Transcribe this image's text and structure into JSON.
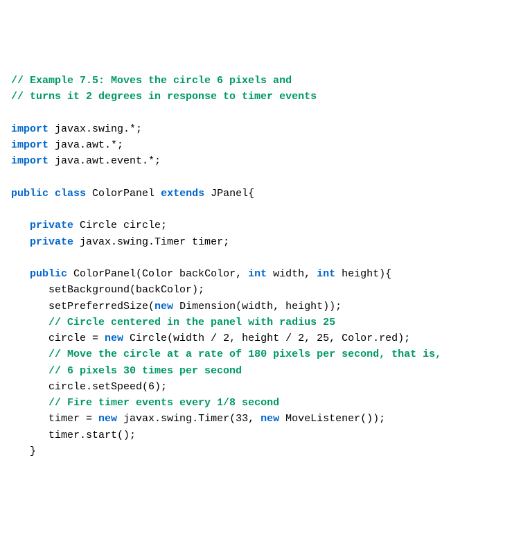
{
  "code": {
    "lines": [
      {
        "segments": [
          {
            "text": "// Example 7.5: Moves the circle 6 pixels and",
            "cls": "cm"
          }
        ]
      },
      {
        "segments": [
          {
            "text": "// turns it 2 degrees in response to timer events",
            "cls": "cm"
          }
        ]
      },
      {
        "segments": [
          {
            "text": "",
            "cls": ""
          }
        ]
      },
      {
        "segments": [
          {
            "text": "import",
            "cls": "kw"
          },
          {
            "text": " javax.swing.*;",
            "cls": ""
          }
        ]
      },
      {
        "segments": [
          {
            "text": "import",
            "cls": "kw"
          },
          {
            "text": " java.awt.*;",
            "cls": ""
          }
        ]
      },
      {
        "segments": [
          {
            "text": "import",
            "cls": "kw"
          },
          {
            "text": " java.awt.event.*;",
            "cls": ""
          }
        ]
      },
      {
        "segments": [
          {
            "text": "",
            "cls": ""
          }
        ]
      },
      {
        "segments": [
          {
            "text": "public class",
            "cls": "kw"
          },
          {
            "text": " ColorPanel ",
            "cls": ""
          },
          {
            "text": "extends",
            "cls": "kw"
          },
          {
            "text": " JPanel{",
            "cls": ""
          }
        ]
      },
      {
        "segments": [
          {
            "text": "",
            "cls": ""
          }
        ]
      },
      {
        "segments": [
          {
            "text": "   ",
            "cls": ""
          },
          {
            "text": "private",
            "cls": "kw"
          },
          {
            "text": " Circle circle;",
            "cls": ""
          }
        ]
      },
      {
        "segments": [
          {
            "text": "   ",
            "cls": ""
          },
          {
            "text": "private",
            "cls": "kw"
          },
          {
            "text": " javax.swing.Timer timer;",
            "cls": ""
          }
        ]
      },
      {
        "segments": [
          {
            "text": "",
            "cls": ""
          }
        ]
      },
      {
        "segments": [
          {
            "text": "   ",
            "cls": ""
          },
          {
            "text": "public",
            "cls": "kw"
          },
          {
            "text": " ColorPanel(Color backColor, ",
            "cls": ""
          },
          {
            "text": "int",
            "cls": "kw"
          },
          {
            "text": " width, ",
            "cls": ""
          },
          {
            "text": "int",
            "cls": "kw"
          },
          {
            "text": " height){",
            "cls": ""
          }
        ]
      },
      {
        "segments": [
          {
            "text": "      setBackground(backColor);",
            "cls": ""
          }
        ]
      },
      {
        "segments": [
          {
            "text": "      setPreferredSize(",
            "cls": ""
          },
          {
            "text": "new",
            "cls": "kw"
          },
          {
            "text": " Dimension(width, height));",
            "cls": ""
          }
        ]
      },
      {
        "segments": [
          {
            "text": "      ",
            "cls": ""
          },
          {
            "text": "// Circle centered in the panel with radius 25",
            "cls": "cm"
          }
        ]
      },
      {
        "segments": [
          {
            "text": "      circle = ",
            "cls": ""
          },
          {
            "text": "new",
            "cls": "kw"
          },
          {
            "text": " Circle(width / 2, height / 2, 25, Color.red);",
            "cls": ""
          }
        ]
      },
      {
        "segments": [
          {
            "text": "      ",
            "cls": ""
          },
          {
            "text": "// Move the circle at a rate of 180 pixels per second, that is,",
            "cls": "cm"
          }
        ]
      },
      {
        "segments": [
          {
            "text": "      ",
            "cls": ""
          },
          {
            "text": "// 6 pixels 30 times per second",
            "cls": "cm"
          }
        ]
      },
      {
        "segments": [
          {
            "text": "      circle.setSpeed(6);",
            "cls": ""
          }
        ]
      },
      {
        "segments": [
          {
            "text": "      ",
            "cls": ""
          },
          {
            "text": "// Fire timer events every 1/8 second",
            "cls": "cm"
          }
        ]
      },
      {
        "segments": [
          {
            "text": "      timer = ",
            "cls": ""
          },
          {
            "text": "new",
            "cls": "kw"
          },
          {
            "text": " javax.swing.Timer(33, ",
            "cls": ""
          },
          {
            "text": "new",
            "cls": "kw"
          },
          {
            "text": " MoveListener());",
            "cls": ""
          }
        ]
      },
      {
        "segments": [
          {
            "text": "      timer.start();",
            "cls": ""
          }
        ]
      },
      {
        "segments": [
          {
            "text": "   }",
            "cls": ""
          }
        ]
      }
    ]
  }
}
